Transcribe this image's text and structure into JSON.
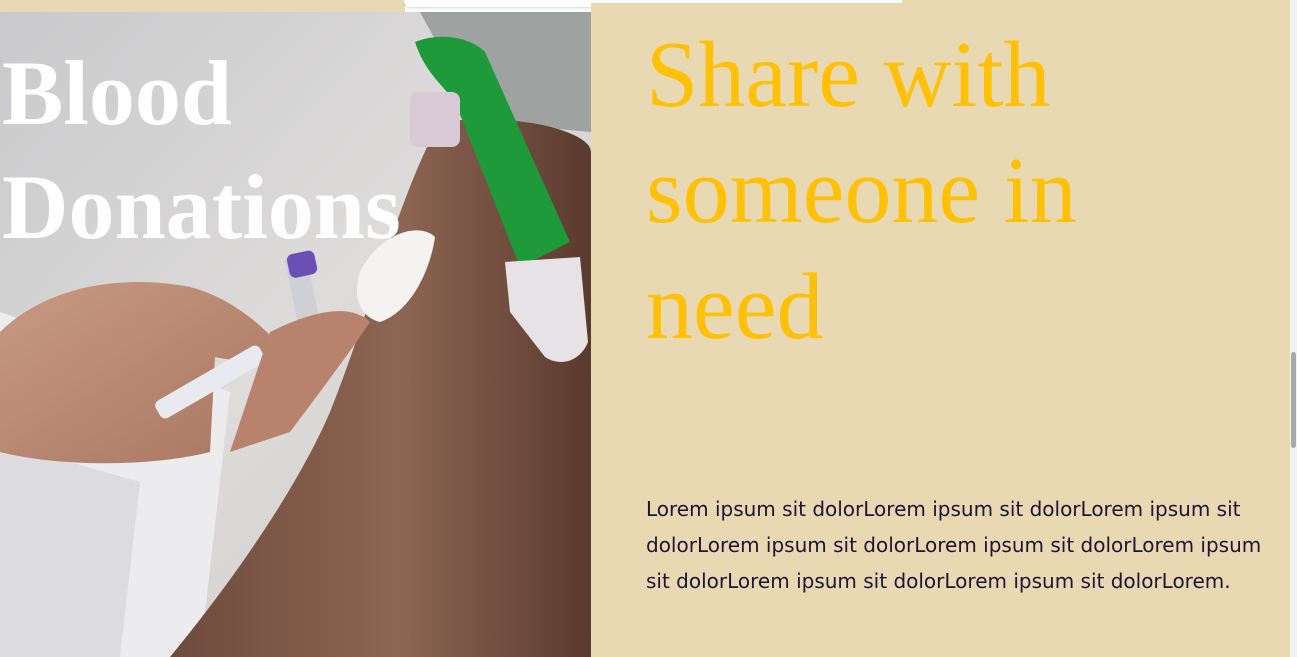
{
  "hero": {
    "title": "Blood\nDonations",
    "image": "blood-draw-photo"
  },
  "content": {
    "headline": "Share with someone in need",
    "body": "Lorem ipsum sit dolorLorem ipsum sit dolorLorem ipsum sit dolorLorem ipsum sit dolorLorem ipsum sit dolorLorem ipsum sit dolorLorem ipsum sit dolorLorem ipsum sit dolorLorem."
  },
  "colors": {
    "panel_background": "#e8d9b2",
    "headline": "#ffc107",
    "body_text": "#1e1433",
    "hero_title": "#ffffff"
  }
}
